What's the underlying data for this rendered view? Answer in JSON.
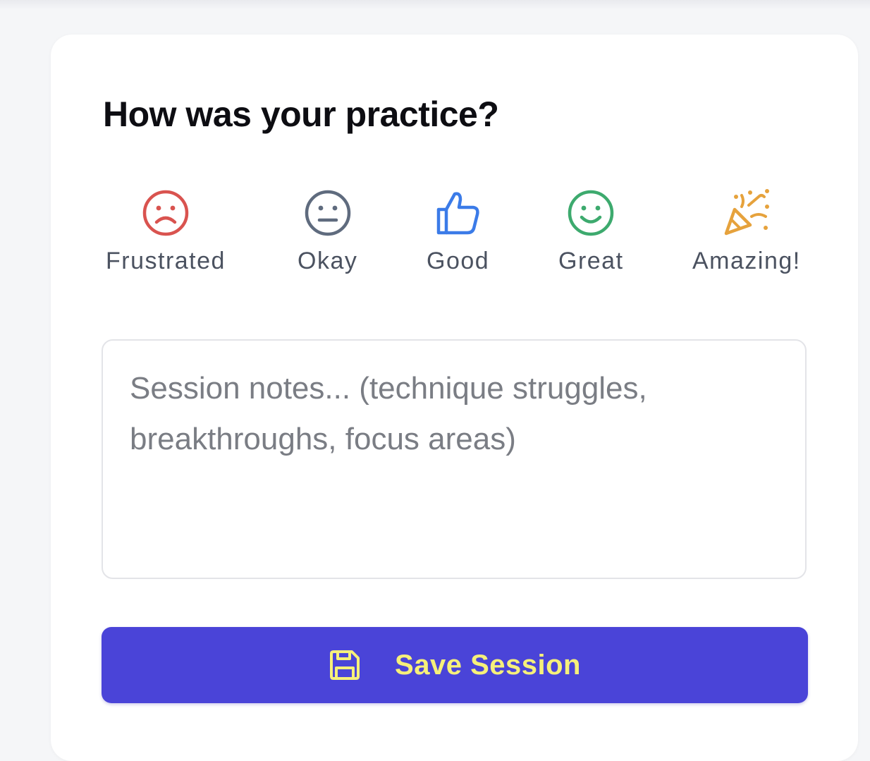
{
  "card": {
    "title": "How was your practice?"
  },
  "moods": [
    {
      "label": "Frustrated",
      "icon": "frown-face-icon",
      "color": "#d9534f"
    },
    {
      "label": "Okay",
      "icon": "neutral-face-icon",
      "color": "#5f6b7e"
    },
    {
      "label": "Good",
      "icon": "thumbs-up-icon",
      "color": "#3b7be8"
    },
    {
      "label": "Great",
      "icon": "smile-face-icon",
      "color": "#3daa6e"
    },
    {
      "label": "Amazing!",
      "icon": "party-popper-icon",
      "color": "#e6a23c"
    }
  ],
  "notes": {
    "placeholder": "Session notes... (technique struggles, breakthroughs, focus areas)",
    "value": ""
  },
  "save_button": {
    "label": "Save Session",
    "icon": "save-icon",
    "background": "#4a44d8",
    "text_color": "#f6f07a"
  }
}
